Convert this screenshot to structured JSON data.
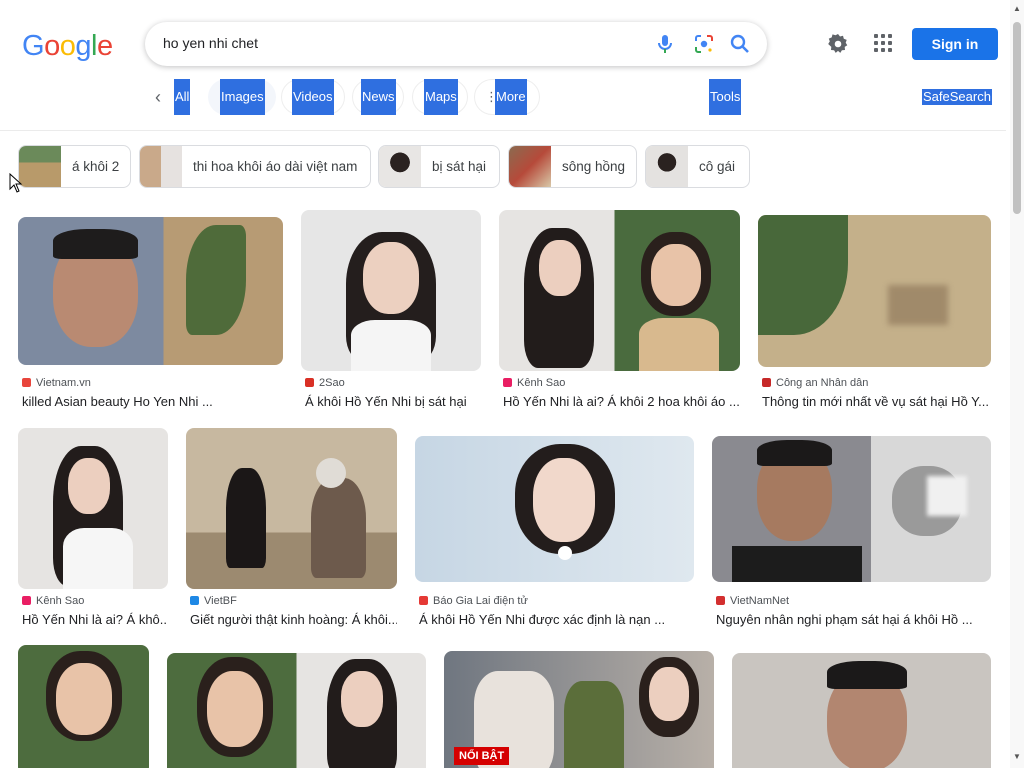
{
  "header": {
    "logo_letters": [
      "G",
      "o",
      "o",
      "g",
      "l",
      "e"
    ],
    "logo_colors": [
      "#4285F4",
      "#EA4335",
      "#FBBC05",
      "#4285F4",
      "#34A853",
      "#EA4335"
    ],
    "query": "ho yen nhi chet",
    "sign_in": "Sign in"
  },
  "tabs": {
    "items": [
      {
        "label": "All"
      },
      {
        "label": "Images"
      },
      {
        "label": "Videos"
      },
      {
        "label": "News"
      },
      {
        "label": "Maps"
      },
      {
        "label": "More"
      }
    ],
    "tools": "Tools",
    "safesearch": "SafeSearch"
  },
  "chips": [
    {
      "label": "á khôi 2"
    },
    {
      "label": "thi hoa khôi áo dài việt nam"
    },
    {
      "label": "bị sát hại"
    },
    {
      "label": "sông hồng"
    },
    {
      "label": "cô gái"
    }
  ],
  "results": [
    {
      "source": "Vietnam.vn",
      "title": "killed Asian beauty Ho Yen Nhi ...",
      "fav": "#e8453c"
    },
    {
      "source": "2Sao",
      "title": "Á khôi Hồ Yến Nhi bị sát hại",
      "fav": "#d93025"
    },
    {
      "source": "Kênh Sao",
      "title": "Hồ Yến Nhi là ai? Á khôi 2 hoa khôi áo ...",
      "fav": "#e91e63"
    },
    {
      "source": "Công an Nhân dân",
      "title": "Thông tin mới nhất về vụ sát hại Hồ Y...",
      "fav": "#c62828"
    },
    {
      "source": "Kênh Sao",
      "title": "Hồ Yến Nhi là ai? Á khô...",
      "fav": "#e91e63"
    },
    {
      "source": "VietBF",
      "title": "Giết người thật kinh hoàng: Á khôi...",
      "fav": "#1e88e5"
    },
    {
      "source": "Báo Gia Lai điện tử",
      "title": "Á khôi Hồ Yến Nhi được xác định là nạn ...",
      "fav": "#e53935"
    },
    {
      "source": "VietNamNet",
      "title": "Nguyên nhân nghi phạm sát hại á khôi Hồ ...",
      "fav": "#d32f2f"
    }
  ],
  "badge": "NỔI BẬT",
  "colors": {
    "accent": "#1a73e8",
    "highlight": "#2f6fe0"
  }
}
